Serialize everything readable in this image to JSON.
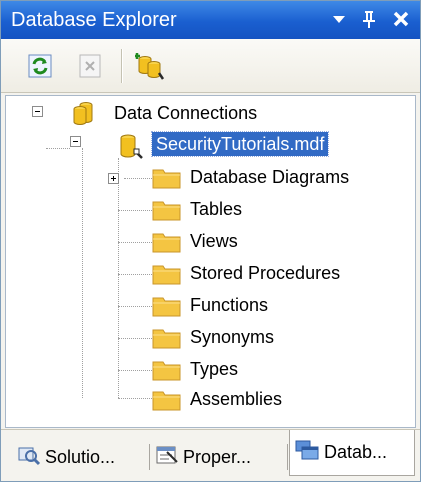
{
  "window": {
    "title": "Database Explorer"
  },
  "titlebar": {
    "buttons": [
      {
        "name": "dropdown-arrow-icon"
      },
      {
        "name": "pin-icon"
      },
      {
        "name": "close-icon"
      }
    ]
  },
  "toolbar": {
    "buttons": [
      {
        "name": "refresh-icon"
      },
      {
        "name": "stop-icon"
      },
      {
        "name": "connect-to-database-icon"
      }
    ]
  },
  "tree": {
    "root": {
      "label": "Data Connections",
      "expanded": true
    },
    "database": {
      "label": "SecurityTutorials.mdf",
      "expanded": true,
      "selected": true
    },
    "children": [
      {
        "label": "Database Diagrams",
        "expandable": true
      },
      {
        "label": "Tables"
      },
      {
        "label": "Views"
      },
      {
        "label": "Stored Procedures"
      },
      {
        "label": "Functions"
      },
      {
        "label": "Synonyms"
      },
      {
        "label": "Types"
      },
      {
        "label": "Assemblies"
      }
    ]
  },
  "tabs": [
    {
      "label": "Solutio...",
      "icon": "solution-explorer-icon",
      "active": false
    },
    {
      "label": "Proper...",
      "icon": "properties-icon",
      "active": false
    },
    {
      "label": "Datab...",
      "icon": "database-explorer-icon",
      "active": true
    }
  ],
  "colors": {
    "title_bar": "#1a5fd0",
    "selection": "#316ac5",
    "folder": "#f4c542"
  }
}
